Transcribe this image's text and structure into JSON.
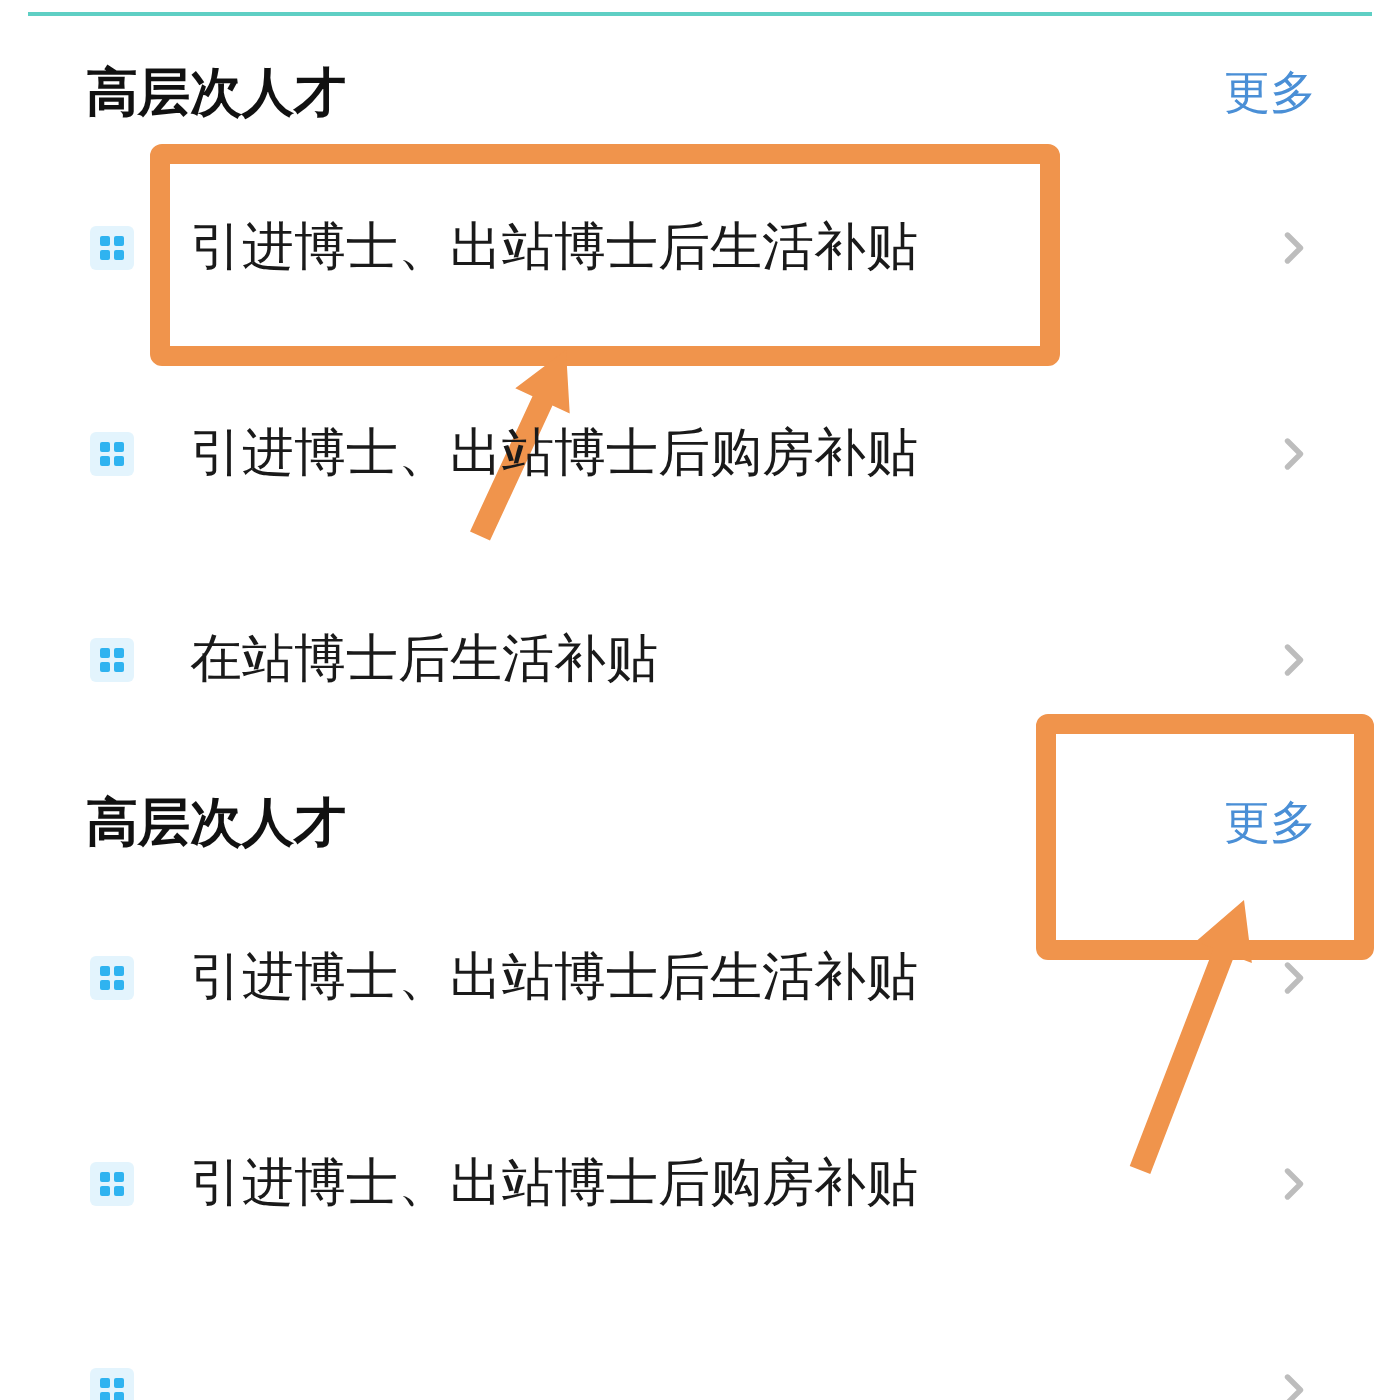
{
  "sections": [
    {
      "title": "高层次人才",
      "more": {
        "label": "更多",
        "highlighted": false
      },
      "items": [
        {
          "label": "引进博士、出站博士后生活补贴",
          "highlighted": true
        },
        {
          "label": "引进博士、出站博士后购房补贴",
          "highlighted": false
        },
        {
          "label": "在站博士后生活补贴",
          "highlighted": false
        }
      ]
    },
    {
      "title": "高层次人才",
      "more": {
        "label": "更多",
        "highlighted": true
      },
      "items": [
        {
          "label": "引进博士、出站博士后生活补贴",
          "highlighted": false
        },
        {
          "label": "引进博士、出站博士后购房补贴",
          "highlighted": false
        },
        {
          "highlighted": false
        }
      ]
    }
  ]
}
